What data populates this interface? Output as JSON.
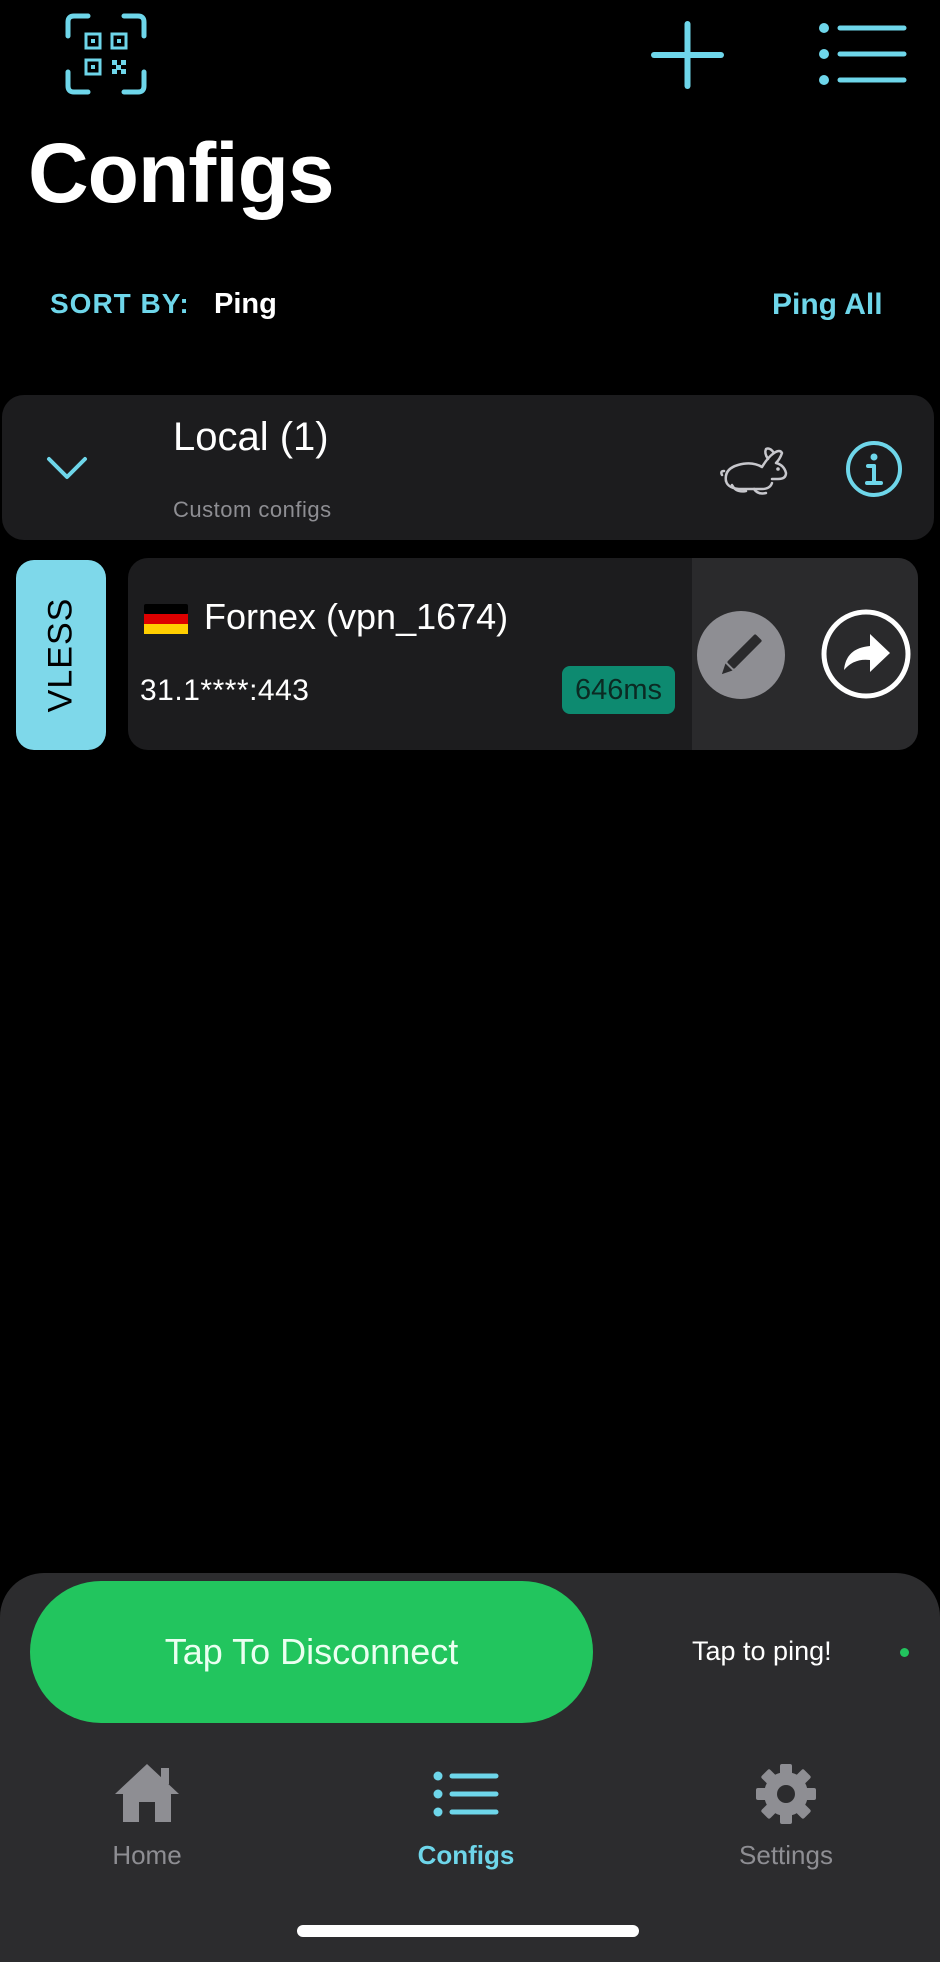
{
  "header": {
    "title": "Configs",
    "qr_icon": "qr-scan-icon",
    "add_icon": "plus-icon",
    "menu_icon": "list-icon"
  },
  "sort": {
    "label": "SORT BY:",
    "value": "Ping",
    "ping_all": "Ping All"
  },
  "group": {
    "title": "Local (1)",
    "subtitle": "Custom configs",
    "icons": [
      "chevron-down-icon",
      "rabbit-icon",
      "info-icon"
    ]
  },
  "config": {
    "protocol": "VLESS",
    "flag": "germany-flag-icon",
    "name": "Fornex (vpn_1674)",
    "address": "31.1****:443",
    "ping": "646ms",
    "actions": [
      "edit-icon",
      "share-icon"
    ]
  },
  "connection": {
    "button_label": "Tap To Disconnect",
    "ping_hint": "Tap to ping!"
  },
  "tabs": [
    {
      "label": "Home",
      "icon": "home-icon",
      "active": false
    },
    {
      "label": "Configs",
      "icon": "list-icon",
      "active": true
    },
    {
      "label": "Settings",
      "icon": "gear-icon",
      "active": false
    }
  ],
  "colors": {
    "accent": "#6ed6ea",
    "connected": "#22c55e",
    "ping_badge": "#0d8a70",
    "card": "#1c1c1e"
  }
}
